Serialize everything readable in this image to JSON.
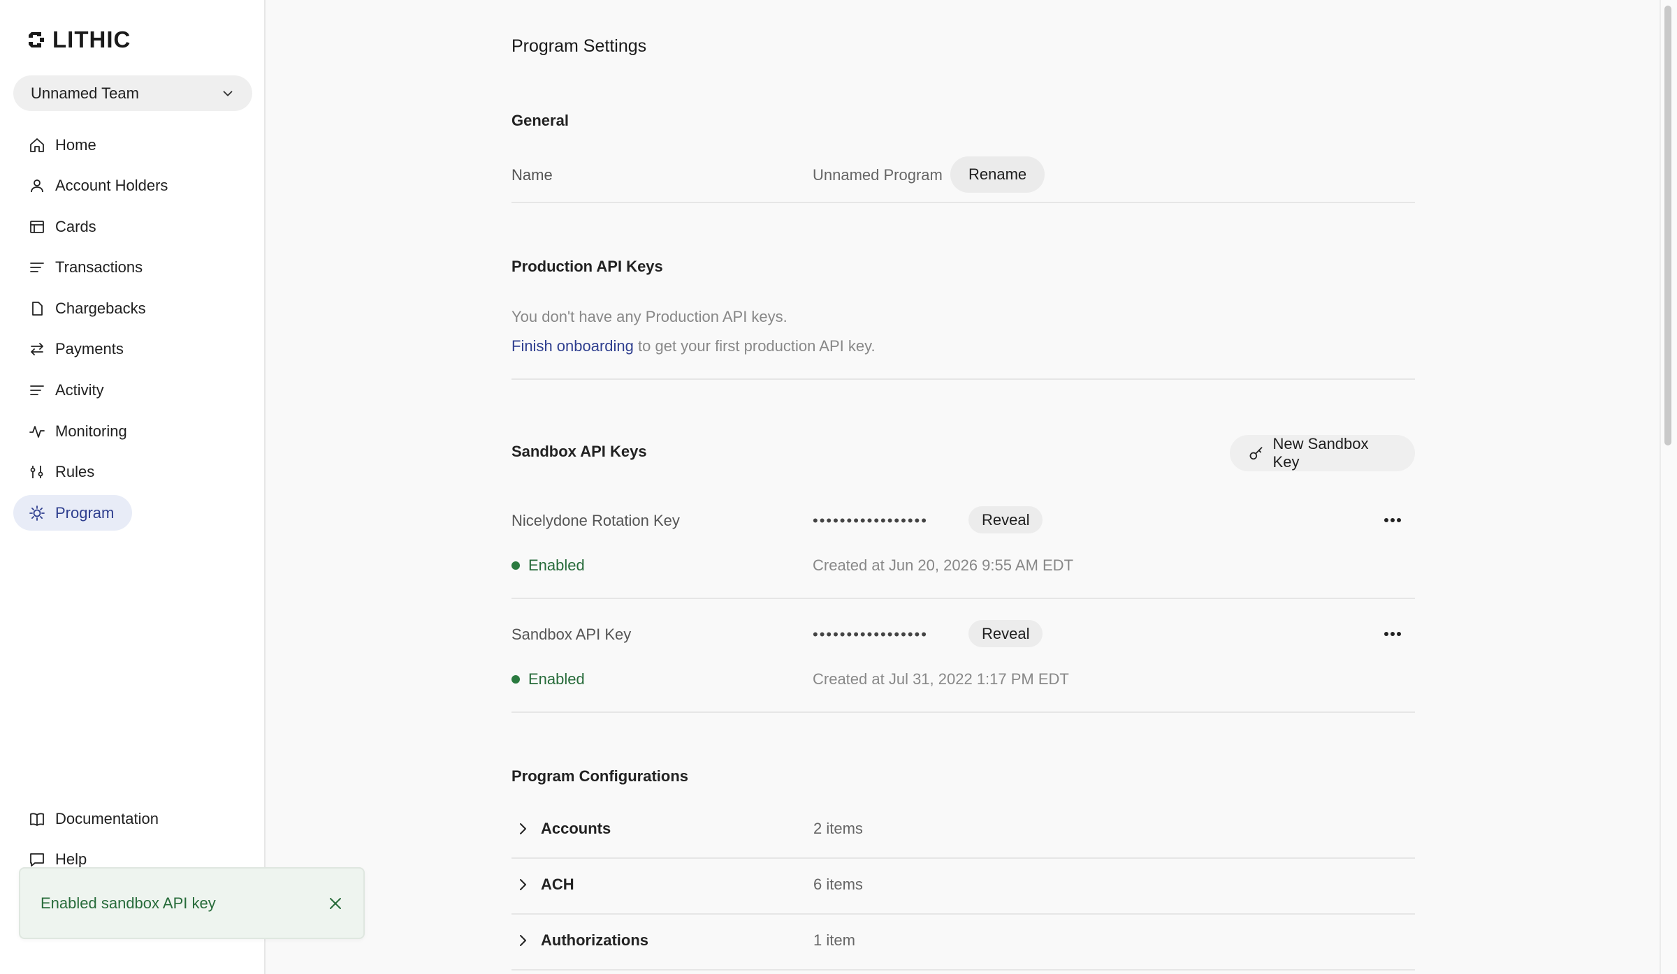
{
  "sidebar": {
    "logo_text": "LITHIC",
    "team": "Unnamed Team",
    "items": [
      {
        "label": "Home",
        "icon": "home-icon"
      },
      {
        "label": "Account Holders",
        "icon": "person-icon"
      },
      {
        "label": "Cards",
        "icon": "card-icon"
      },
      {
        "label": "Transactions",
        "icon": "list-icon"
      },
      {
        "label": "Chargebacks",
        "icon": "document-icon"
      },
      {
        "label": "Payments",
        "icon": "arrows-icon"
      },
      {
        "label": "Activity",
        "icon": "list-icon"
      },
      {
        "label": "Monitoring",
        "icon": "pulse-icon"
      },
      {
        "label": "Rules",
        "icon": "sliders-icon"
      },
      {
        "label": "Program",
        "icon": "gear-icon",
        "active": true
      }
    ],
    "bottom_items": [
      {
        "label": "Documentation",
        "icon": "book-icon"
      },
      {
        "label": "Help",
        "icon": "chat-icon"
      }
    ]
  },
  "toast": {
    "message": "Enabled sandbox API key"
  },
  "main": {
    "title": "Program Settings",
    "general": {
      "title": "General",
      "name_label": "Name",
      "name_value": "Unnamed Program",
      "rename_label": "Rename"
    },
    "production": {
      "title": "Production API Keys",
      "empty_text": "You don't have any Production API keys.",
      "link_text": "Finish onboarding",
      "after_link": " to get your first production API key."
    },
    "sandbox": {
      "title": "Sandbox API Keys",
      "new_key_label": "New Sandbox Key",
      "keys": [
        {
          "name": "Nicelydone Rotation Key",
          "masked": "•••••••••••••••••",
          "reveal": "Reveal",
          "status": "Enabled",
          "created": "Created at Jun 20, 2026 9:55 AM EDT"
        },
        {
          "name": "Sandbox API Key",
          "masked": "•••••••••••••••••",
          "reveal": "Reveal",
          "status": "Enabled",
          "created": "Created at Jul 31, 2022 1:17 PM EDT"
        }
      ]
    },
    "configurations": {
      "title": "Program Configurations",
      "rows": [
        {
          "name": "Accounts",
          "count": "2 items"
        },
        {
          "name": "ACH",
          "count": "6 items"
        },
        {
          "name": "Authorizations",
          "count": "1 item"
        }
      ]
    }
  },
  "colors": {
    "accent": "#2f3f8f",
    "active_nav_bg": "#e8ecf7",
    "success": "#276b3a"
  }
}
